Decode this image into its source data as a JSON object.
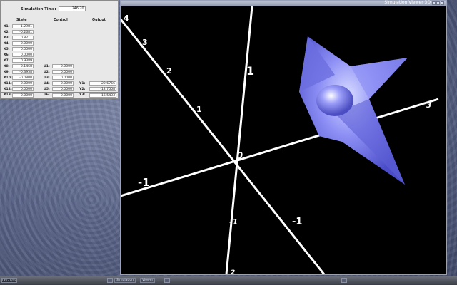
{
  "desktop": {
    "clock": "06/21/09"
  },
  "window": {
    "title": "Simulation Viewer 3D"
  },
  "panel": {
    "sim_time_label": "Simulation Time:",
    "sim_time_value": "246.70",
    "headers": {
      "state": "State",
      "control": "Control",
      "output": "Output"
    },
    "states": [
      {
        "label": "X1:",
        "value": "1.2981"
      },
      {
        "label": "X2:",
        "value": "-0.2681"
      },
      {
        "label": "X3:",
        "value": "0.8211"
      },
      {
        "label": "X4:",
        "value": "0.0000"
      },
      {
        "label": "X5:",
        "value": "0.0000"
      },
      {
        "label": "X6:",
        "value": "0.0000"
      },
      {
        "label": "X7:",
        "value": "0.9389"
      },
      {
        "label": "X8:",
        "value": "0.1468"
      },
      {
        "label": "X9:",
        "value": "-0.3958"
      },
      {
        "label": "X10:",
        "value": "-0.0800"
      },
      {
        "label": "X11:",
        "value": "0.0000"
      },
      {
        "label": "X12:",
        "value": "0.0000"
      },
      {
        "label": "X13:",
        "value": "0.0000"
      }
    ],
    "controls": [
      {
        "label": "U1:",
        "value": "0.0000"
      },
      {
        "label": "U2:",
        "value": "0.0000"
      },
      {
        "label": "U3:",
        "value": "0.0000"
      },
      {
        "label": "U4:",
        "value": "0.0000"
      },
      {
        "label": "U5:",
        "value": "0.0000"
      },
      {
        "label": "U6:",
        "value": "0.0000"
      }
    ],
    "outputs": [
      {
        "label": "Y1:",
        "value": "22.6766"
      },
      {
        "label": "Y2:",
        "value": "-12.7558"
      },
      {
        "label": "Y3:",
        "value": "-16.5433"
      }
    ]
  },
  "scene": {
    "background": "#000000",
    "object_color": "#7a7cf0",
    "axis_labels": {
      "origin": "0",
      "a1": "1",
      "a2": "2",
      "a3": "3",
      "a4": "4",
      "b1": "1",
      "c_neg": "-1",
      "c3": "3",
      "d_neg": "-1",
      "e_neg": "-1",
      "f2": "2"
    }
  },
  "taskbar": {
    "items": [
      "Simulation",
      "Viewer"
    ]
  }
}
